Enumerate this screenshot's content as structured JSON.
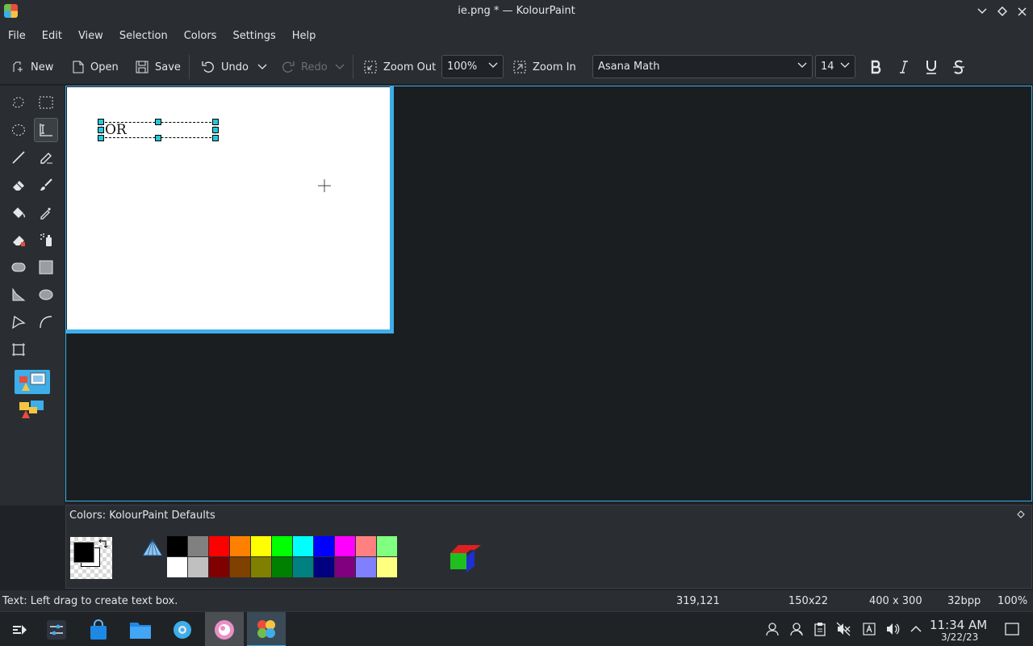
{
  "window": {
    "title": "ie.png * — KolourPaint"
  },
  "menu": [
    "File",
    "Edit",
    "View",
    "Selection",
    "Colors",
    "Settings",
    "Help"
  ],
  "toolbar": {
    "new_label": "New",
    "open_label": "Open",
    "save_label": "Save",
    "undo_label": "Undo",
    "redo_label": "Redo",
    "zoom_out_label": "Zoom Out",
    "zoom_value": "100%",
    "zoom_in_label": "Zoom In",
    "font_family": "Asana Math",
    "font_size": "14"
  },
  "tools": [
    "free-form-selection",
    "rectangular-selection",
    "elliptical-selection",
    "text",
    "line",
    "pen",
    "eraser",
    "brush",
    "flood-fill",
    "color-picker",
    "color-eraser",
    "spraycan",
    "rounded-rectangle",
    "rectangle",
    "polygon",
    "ellipse",
    "connected-lines",
    "curve",
    "zoom"
  ],
  "canvas": {
    "text_content": "OR"
  },
  "colors": {
    "title": "Colors: KolourPaint Defaults",
    "foreground": "#000000",
    "background": "#ffffff",
    "palette_top": [
      "#000000",
      "#808080",
      "#ff0000",
      "#ff8000",
      "#ffff00",
      "#00ff00",
      "#00ffff",
      "#0000ff",
      "#ff00ff",
      "#ff8080",
      "#80ff80"
    ],
    "palette_bottom": [
      "#ffffff",
      "#c0c0c0",
      "#800000",
      "#804000",
      "#808000",
      "#008000",
      "#008080",
      "#000080",
      "#800080",
      "#8080ff",
      "#ffff80"
    ]
  },
  "status": {
    "message": "Text: Left drag to create text box.",
    "cursor_pos": "319,121",
    "selection_size": "150x22",
    "image_size": "400 x 300",
    "depth": "32bpp",
    "zoom": "100%"
  },
  "taskbar": {
    "time": "11:34 AM",
    "date": "3/22/23"
  }
}
